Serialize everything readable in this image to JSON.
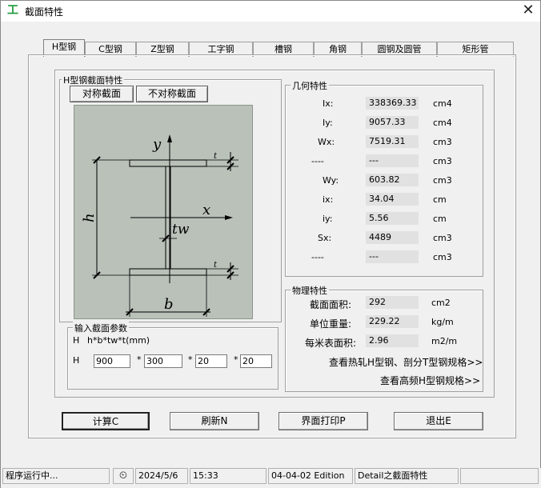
{
  "window": {
    "title": "截面特性",
    "close_glyph": "✕",
    "app_icon_glyph": "工"
  },
  "tabs": [
    "H型钢",
    "C型钢",
    "Z型钢",
    "工字钢",
    "槽钢",
    "角钢",
    "圆钢及圆管",
    "矩形管"
  ],
  "section_group": {
    "title": "H型钢截面特性",
    "sym_button": "对称截面",
    "asym_button": "不对称截面"
  },
  "diagram": {
    "y_label": "y",
    "x_label": "x",
    "tw_label": "tw",
    "h_label": "h",
    "b_label": "b"
  },
  "input_group": {
    "title": "输入截面参数",
    "formula_prefix": "H",
    "formula": "h*b*tw*t(mm)",
    "row_prefix": "H",
    "h_value": "900",
    "b_value": "300",
    "tw_value": "20",
    "t_value": "20",
    "separator": "*"
  },
  "geometry_group": {
    "title": "几何特性",
    "rows": [
      {
        "label": "Ix:",
        "value": "338369.33",
        "unit": "cm4"
      },
      {
        "label": "Iy:",
        "value": "9057.33",
        "unit": "cm4"
      },
      {
        "label": "Wx:",
        "value": "7519.31",
        "unit": "cm3"
      },
      {
        "label": "----",
        "value": "---",
        "unit": "cm3"
      },
      {
        "label": "Wy:",
        "value": "603.82",
        "unit": "cm3"
      },
      {
        "label": "ix:",
        "value": "34.04",
        "unit": "cm"
      },
      {
        "label": "iy:",
        "value": "5.56",
        "unit": "cm"
      },
      {
        "label": "Sx:",
        "value": "4489",
        "unit": "cm3"
      },
      {
        "label": "----",
        "value": "---",
        "unit": "cm3"
      }
    ]
  },
  "physical_group": {
    "title": "物理特性",
    "rows": [
      {
        "label": "截面面积:",
        "value": "292",
        "unit": "cm2"
      },
      {
        "label": "单位重量:",
        "value": "229.22",
        "unit": "kg/m"
      },
      {
        "label": "每米表面积:",
        "value": "2.96",
        "unit": "m2/m"
      }
    ],
    "link1": "查看热轧H型钢、剖分T型钢规格>>",
    "link2": "查看高频H型钢规格>>"
  },
  "buttons": {
    "calc": "计算C",
    "refresh": "刷新N",
    "print": "界面打印P",
    "exit": "退出E"
  },
  "statusbar": {
    "status": "程序运行中...",
    "date": "2024/5/6",
    "time": "15:33",
    "edition": "04-04-02 Edition",
    "detail": "Detail之截面特性"
  }
}
